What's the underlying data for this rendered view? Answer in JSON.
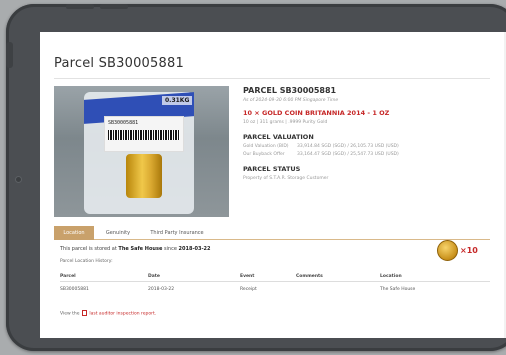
{
  "parcel": {
    "page_title": "Parcel SB30005881",
    "heading": "PARCEL SB30005881",
    "as_of": "As of 2024-09-30 6:00 PM Singapore Time",
    "product": "10 × GOLD COIN BRITANNIA 2014 - 1 OZ",
    "weight": "10 oz | 311 grams | .9999 Purity Gold",
    "valuation_heading": "PARCEL VALUATION",
    "valuation": [
      {
        "label": "Gold Valuation (BID)",
        "value": "33,914.84 SGD (SGD) / 26,105.73 USD (USD)"
      },
      {
        "label": "Our Buyback Offer",
        "value": "33,164.47 SGD (SGD) / 25,547.73 USD (USD)"
      }
    ],
    "status_heading": "PARCEL STATUS",
    "status": "Property of S.T.A.R. Storage Customer",
    "photo_label": "0.31KG",
    "barcode_text": "SB30005881"
  },
  "tabs": [
    {
      "label": "Location",
      "active": true
    },
    {
      "label": "Genuinity",
      "active": false
    },
    {
      "label": "Third Party Insurance",
      "active": false
    }
  ],
  "location": {
    "stored_prefix": "This parcel is stored at",
    "stored_place": "The Safe House",
    "stored_mid": "since",
    "stored_date": "2018-03-22",
    "history_label": "Parcel Location History:",
    "columns": [
      "Parcel",
      "Date",
      "Event",
      "Comments",
      "Location"
    ],
    "rows": [
      [
        "SB30005881",
        "2018-03-22",
        "Receipt",
        "",
        "The Safe House"
      ]
    ],
    "audit_prefix": "View the",
    "audit_link": "last auditor inspection report."
  },
  "coin_count": "×10",
  "colors": {
    "accent": "#c9a16b",
    "red": "#c62828"
  }
}
